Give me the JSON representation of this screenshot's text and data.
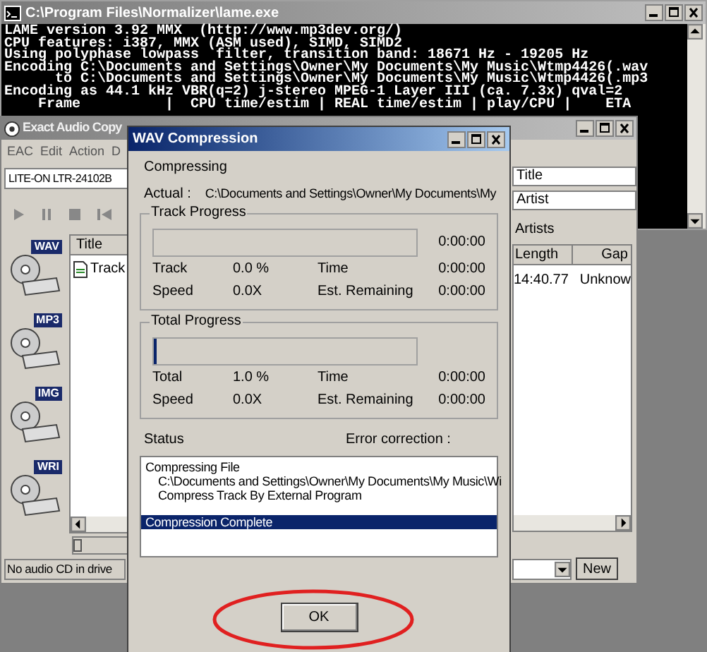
{
  "console": {
    "title": "C:\\Program Files\\Normalizer\\lame.exe",
    "lines": [
      "LAME version 3.92 MMX  (http://www.mp3dev.org/)",
      "CPU features: i387, MMX (ASM used), SIMD, SIMD2",
      "Using polyphase lowpass  filter, transition band: 18671 Hz - 19205 Hz",
      "Encoding C:\\Documents and Settings\\Owner\\My Documents\\My Music\\Wtmp4426(.wav",
      "      to C:\\Documents and Settings\\Owner\\My Documents\\My Music\\Wtmp4426(.mp3",
      "Encoding as 44.1 kHz VBR(q=2) j-stereo MPEG-1 Layer III (ca. 7.3x) qval=2",
      "    Frame          |  CPU time/estim | REAL time/estim | play/CPU |    ETA"
    ]
  },
  "eac": {
    "title": "Exact Audio Copy",
    "menu": [
      "EAC",
      "Edit",
      "Action",
      "D"
    ],
    "drive": "LITE-ON LTR-24102B",
    "modes": [
      "WAV",
      "MP3",
      "IMG",
      "WRI"
    ],
    "list": {
      "column": "Title",
      "row": "Track"
    },
    "seek_slider": {
      "level": 0
    },
    "album_title": "Title",
    "album_artist": "Artist",
    "artists_label": "Artists",
    "table": {
      "columns": [
        "Length",
        "Gap"
      ],
      "row": [
        "14:40.77",
        "Unknow"
      ]
    },
    "status": "No audio CD in drive",
    "new_button": "New"
  },
  "dialog": {
    "title": "WAV Compression",
    "heading": "Compressing",
    "actual_label": "Actual :",
    "actual_path": "C:\\Documents and Settings\\Owner\\My Documents\\My",
    "groups": [
      {
        "title": "Track Progress",
        "level": 0,
        "elapsed": "0:00:00",
        "rows": [
          [
            "Track",
            "0.0 %",
            "Time",
            "0:00:00"
          ],
          [
            "Speed",
            "0.0X",
            "Est. Remaining",
            "0:00:00"
          ]
        ]
      },
      {
        "title": "Total Progress",
        "level": 0.01,
        "rows": [
          [
            "Total",
            "1.0 %",
            "Time",
            "0:00:00"
          ],
          [
            "Speed",
            "0.0X",
            "Est. Remaining",
            "0:00:00"
          ]
        ]
      }
    ],
    "status_label": "Status",
    "error_label": "Error correction :",
    "status_items": [
      {
        "text": "Compressing File",
        "selected": false,
        "children": [
          {
            "text": "C:\\Documents and Settings\\Owner\\My Documents\\My Music\\Wi",
            "selected": false
          },
          {
            "text": "Compress Track By External Program",
            "selected": false
          }
        ]
      },
      {
        "text": "Compression Complete",
        "selected": true
      }
    ],
    "ok_button": "OK"
  }
}
